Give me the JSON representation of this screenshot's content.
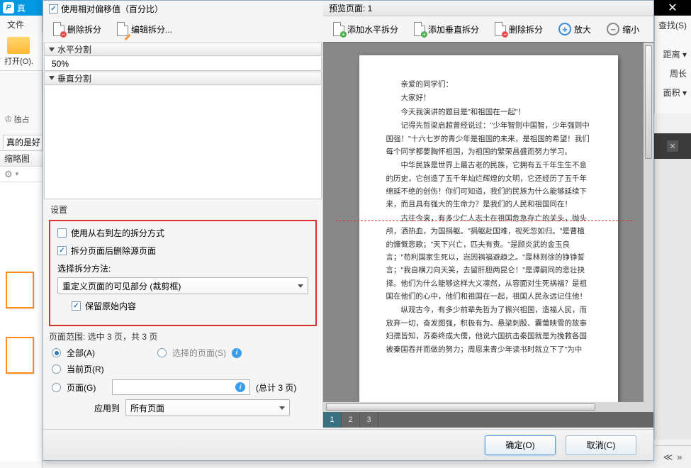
{
  "bg": {
    "title_fragment": "真",
    "menu_file": "文件",
    "open_label": "打开(O).",
    "crown_label": "独占",
    "doc_tab": "真的是好",
    "thumb_header": "缩略图",
    "right_items": [
      "查找(S)",
      "距离 ▾",
      "周长",
      "面积 ▾"
    ]
  },
  "dialog": {
    "use_relative_offset": "使用相对偏移值（百分比）",
    "btn_delete_split": "删除拆分",
    "btn_edit_split": "编辑拆分...",
    "h_split_header": "水平分割",
    "h_split_value": "50%",
    "v_split_header": "垂直分割",
    "preview_title": "预览页面: 1",
    "btn_add_h": "添加水平拆分",
    "btn_add_v": "添加垂直拆分",
    "btn_del_split": "删除拆分",
    "btn_zoom_in": "放大",
    "btn_zoom_out": "缩小",
    "settings_title": "设置",
    "chk_rtl": "使用从右到左的拆分方式",
    "chk_delete_source": "拆分页面后删除源页面",
    "method_label": "选择拆分方法:",
    "method_value": "重定义页面的可见部分 (裁剪框)",
    "chk_keep_original": "保留原始内容",
    "page_range_title": "页面范围: 选中 3 页，共 3 页",
    "radio_all": "全部(A)",
    "radio_selected": "选择的页面(S)",
    "radio_current": "当前页(R)",
    "radio_pages": "页面(G)",
    "pages_total": "(总计 3 页)",
    "apply_to_label": "应用到",
    "apply_to_value": "所有页面",
    "page_nums": [
      "1",
      "2",
      "3"
    ],
    "ok": "确定(O)",
    "cancel": "取消(C)"
  },
  "doc": {
    "p1": "亲爱的同学们：",
    "p2": "大家好！",
    "p3": "今天我演讲的题目是\"和祖国在一起\"！",
    "p4": "记得先哲梁启超曾经说过：\"少年智则中国智，少年强则中国强！\"十六七岁的青少年是祖国的未来，是祖国的希望！我们每个同学都要胸怀祖国，为祖国的繁荣昌盛而努力学习。",
    "p5": "中华民族是世界上最古老的民族，它拥有五千年生生不息的历史，它创造了五千年灿烂辉煌的文明，它还经历了五千年绵延不绝的创伤！你们可知道，我们的民族为什么能够延续下来，而且具有强大的生命力？是我们的人民和祖国同在！",
    "p6": "古往今来，有多少仁人志士在祖国危急存亡的关头，抛头颅，洒热血，为国捐躯。\"捐躯赴国难，视死忽如归。\"是曹植的慷慨悲歌；\"天下兴亡，匹夫有责。\"是顾炎武的金玉良言；\"苟利国家生死以，岂因祸福避趋之。\"是林则徐的铮铮誓言；\"我自横刀向天笑，去留肝胆两昆仑！\"是谭嗣同的悲壮抉择。他们为什么能够这样大义凛然，从容面对生死祸福？是祖国在他们的心中，他们和祖国在一起，祖国人民永远记住他！",
    "p7": "纵观古今，有多少前辈先哲为了振兴祖国，造福人民，而放弃一切，奋发图强，积极有为。悬梁刺股、囊萤映雪的故事妇孺皆知，苏秦终成大儒，他说六国抗击秦国就是为挽救各国被秦国吞并而做的努力；周恩来青少年读书时就立下了\"为中"
  }
}
